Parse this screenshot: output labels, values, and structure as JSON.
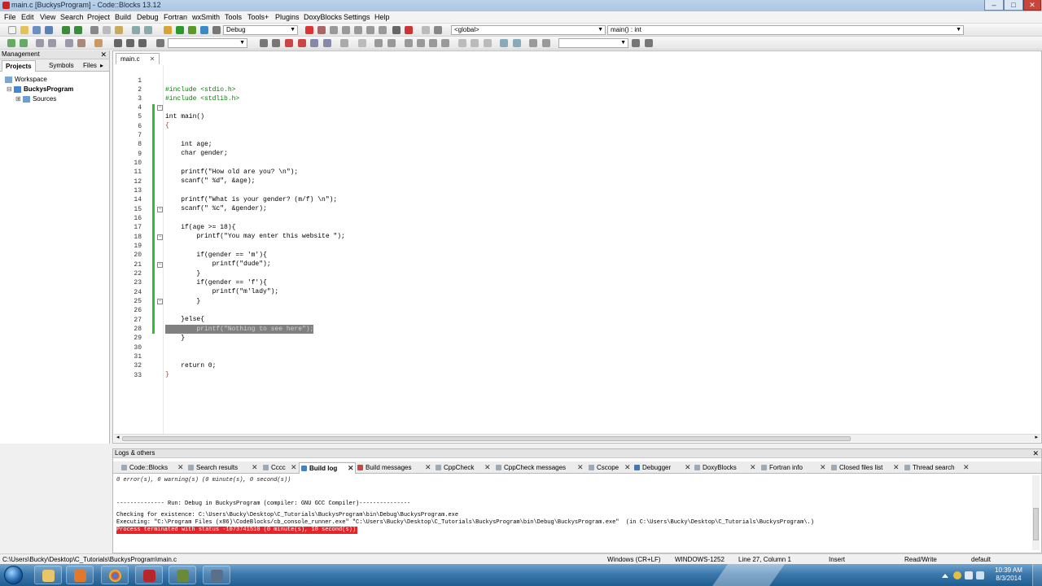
{
  "window": {
    "title": "main.c [BuckysProgram] - Code::Blocks 13.12"
  },
  "menu": [
    "File",
    "Edit",
    "View",
    "Search",
    "Project",
    "Build",
    "Debug",
    "Fortran",
    "wxSmith",
    "Tools",
    "Tools+",
    "Plugins",
    "DoxyBlocks",
    "Settings",
    "Help"
  ],
  "toolbar": {
    "build_target": "Debug",
    "scope": "<global>",
    "function": "main() : int"
  },
  "management": {
    "header": "Management",
    "tabs": [
      "Projects",
      "Symbols",
      "Files"
    ],
    "tree": {
      "workspace": "Workspace",
      "project": "BuckysProgram",
      "sources": "Sources"
    }
  },
  "editor": {
    "file_tab": "main.c",
    "lines": [
      "#include <stdio.h>",
      "#include <stdlib.h>",
      "",
      "int main()",
      "{",
      "",
      "    int age;",
      "    char gender;",
      "",
      "    printf(\"How old are you? \\n\");",
      "    scanf(\" %d\", &age);",
      "",
      "    printf(\"What is your gender? (m/f) \\n\");",
      "    scanf(\" %c\", &gender);",
      "",
      "    if(age >= 18){",
      "        printf(\"You may enter this website \");",
      "",
      "        if(gender == 'm'){",
      "            printf(\"dude\");",
      "        }",
      "        if(gender == 'f'){",
      "            printf(\"m'lady\");",
      "        }",
      "",
      "    }else{",
      "        printf(\"Nothing to see here\");",
      "    }",
      "",
      "",
      "    return 0;",
      "}",
      ""
    ]
  },
  "logs": {
    "header": "Logs & others",
    "tabs": [
      "Code::Blocks",
      "Search results",
      "Cccc",
      "Build log",
      "Build messages",
      "CppCheck",
      "CppCheck messages",
      "Cscope",
      "Debugger",
      "DoxyBlocks",
      "Fortran info",
      "Closed files list",
      "Thread search"
    ],
    "active_tab": "Build log",
    "output": [
      "0 error(s), 0 warning(s) (0 minute(s), 0 second(s))",
      "",
      "",
      "-------------- Run: Debug in BuckysProgram (compiler: GNU GCC Compiler)---------------",
      "",
      "Checking for existence: C:\\Users\\Bucky\\Desktop\\C_Tutorials\\BuckysProgram\\bin\\Debug\\BuckysProgram.exe",
      "Executing: \"C:\\Program Files (x86)\\CodeBlocks/cb_console_runner.exe\" \"C:\\Users\\Bucky\\Desktop\\C_Tutorials\\BuckysProgram\\bin\\Debug\\BuckysProgram.exe\"  (in C:\\Users\\Bucky\\Desktop\\C_Tutorials\\BuckysProgram\\.)",
      "Process terminated with status -1073741510 (0 minute(s), 10 second(s))"
    ]
  },
  "status": {
    "path": "C:\\Users\\Bucky\\Desktop\\C_Tutorials\\BuckysProgram\\main.c",
    "eol": "Windows (CR+LF)",
    "encoding": "WINDOWS-1252",
    "position": "Line 27, Column 1",
    "mode": "Insert",
    "access": "Read/Write",
    "lang": "default"
  },
  "taskbar": {
    "time": "10:39 AM",
    "date": "8/3/2014"
  },
  "colors": {
    "title_bar": "#a9c6e3",
    "preprocessor": "#0a7a0a",
    "keyword": "#00008b",
    "string": "#0000cc",
    "number": "#d03020",
    "change_bar": "#2ec02e",
    "error_highlight": "#e8232a",
    "selection": "#808080"
  }
}
